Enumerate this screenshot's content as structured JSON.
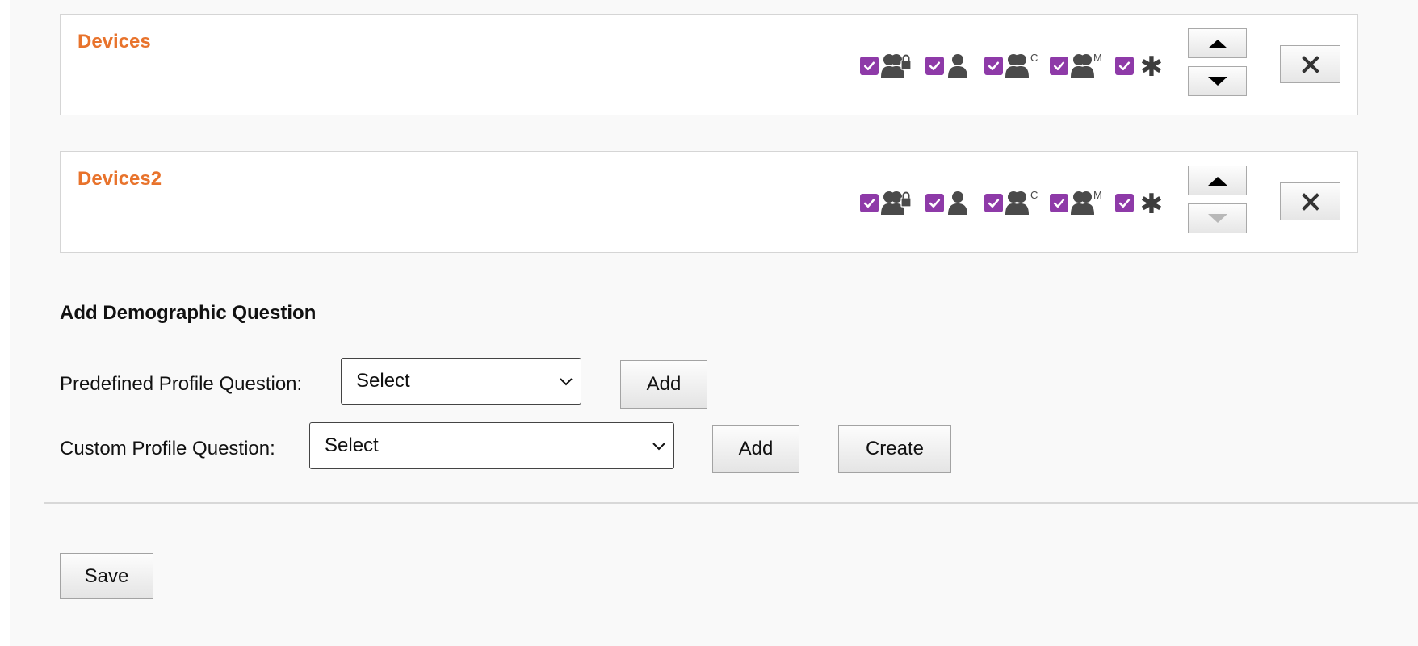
{
  "questions": [
    {
      "title": "Devices",
      "down_enabled": true
    },
    {
      "title": "Devices2",
      "down_enabled": false
    }
  ],
  "option_icons": [
    "private-profile-icon",
    "profile-icon",
    "profile-c-icon",
    "profile-m-icon",
    "required-asterisk-icon"
  ],
  "option_icon_letters": {
    "c": "C",
    "m": "M",
    "asterisk": "✱"
  },
  "add_section": {
    "title": "Add Demographic Question",
    "predefined_label": "Predefined Profile Question:",
    "predefined_value": "Select",
    "custom_label": "Custom Profile Question:",
    "custom_value": "Select",
    "add_label": "Add",
    "create_label": "Create"
  },
  "save_label": "Save",
  "colors": {
    "title_accent": "#e8732c",
    "checkbox": "#8e3aa8",
    "icon_gray": "#4a4a4a"
  }
}
